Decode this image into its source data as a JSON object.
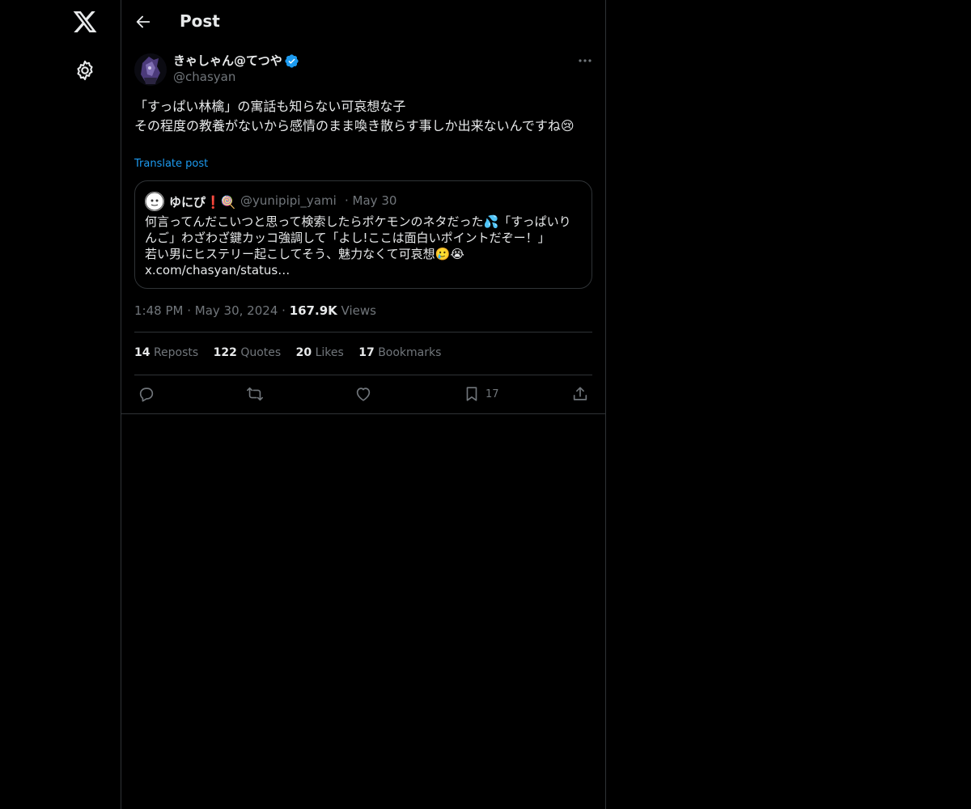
{
  "sidebar": {
    "logo_icon": "x-logo-icon",
    "settings_icon": "gear-icon"
  },
  "header": {
    "title": "Post",
    "back_icon": "arrow-left-icon"
  },
  "post": {
    "author_name": "きゃしゃん@てつや",
    "author_handle": "@chasyan",
    "verified": true,
    "text": "「すっぱい林檎」の寓話も知らない可哀想な子\nその程度の教養がないから感情のまま喚き散らす事しか出来ないんですね😢",
    "translate_label": "Translate post",
    "time": "1:48 PM",
    "date": "May 30, 2024",
    "views_count": "167.9K",
    "views_label": "Views"
  },
  "quote": {
    "author_name": "ゆにぴ❗🍭",
    "author_handle": "@yunipipi_yami",
    "date": "May 30",
    "text": "何言ってんだこいつと思って検索したらポケモンのネタだった💦「すっぱいりんご」わざわざ鍵カッコ強調して「よし!ここは面白いポイントだぞー！」\n若い男にヒステリー起こしてそう、魅力なくて可哀想🥲😭\nx.com/chasyan/status…"
  },
  "stats": {
    "reposts_count": "14",
    "reposts_label": "Reposts",
    "quotes_count": "122",
    "quotes_label": "Quotes",
    "likes_count": "20",
    "likes_label": "Likes",
    "bookmarks_count": "17",
    "bookmarks_label": "Bookmarks"
  },
  "actions": {
    "bookmark_count": "17"
  },
  "colors": {
    "accent": "#1d9bf0",
    "background": "#000000",
    "text": "#e7e9ea",
    "muted": "#71767b",
    "border": "#2f3336"
  }
}
